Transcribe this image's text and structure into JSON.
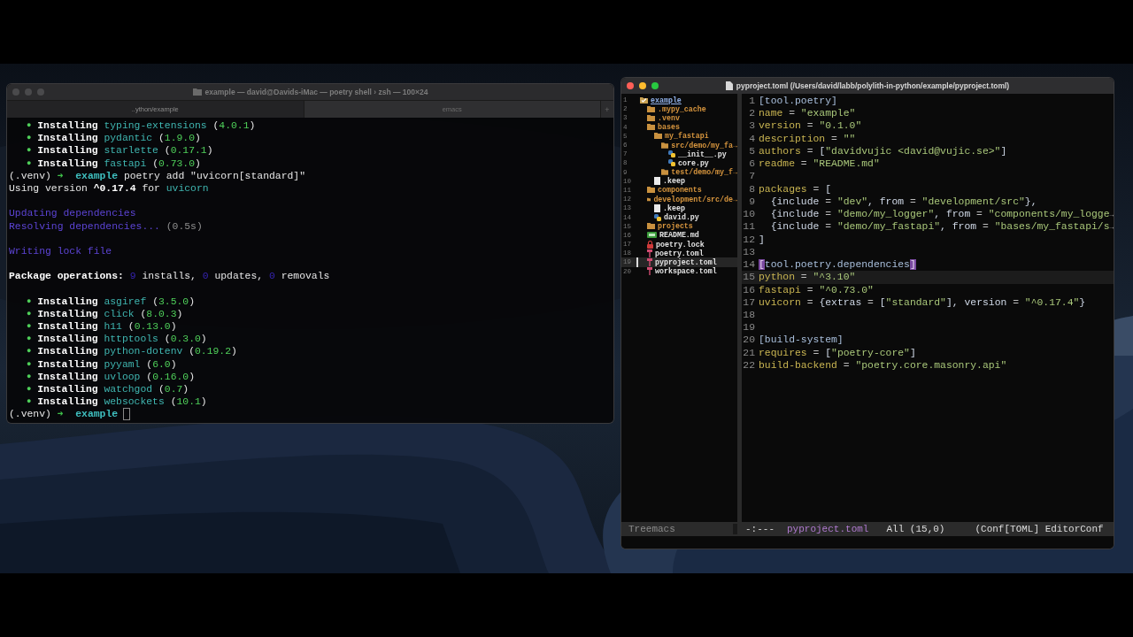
{
  "terminal": {
    "title": "example — david@Davids-iMac — poetry shell › zsh — 100×24",
    "tabs": [
      {
        "label": "..ython/example",
        "selected": true
      },
      {
        "label": "emacs",
        "selected": false
      }
    ],
    "new_tab": "+",
    "lines": [
      {
        "kind": "text",
        "segments": [
          {
            "text": "●",
            "kind": "bullet"
          },
          {
            "text": " Installing ",
            "kind": "bold"
          },
          {
            "text": "typing-extensions",
            "kind": "pkg"
          },
          {
            "text": " (",
            "kind": "plain"
          },
          {
            "text": "4.0.1",
            "kind": "ver"
          },
          {
            "text": ")",
            "kind": "plain"
          }
        ]
      },
      {
        "kind": "text",
        "segments": [
          {
            "text": "●",
            "kind": "bullet"
          },
          {
            "text": " Installing ",
            "kind": "bold"
          },
          {
            "text": "pydantic",
            "kind": "pkg"
          },
          {
            "text": " (",
            "kind": "plain"
          },
          {
            "text": "1.9.0",
            "kind": "ver"
          },
          {
            "text": ")",
            "kind": "plain"
          }
        ]
      },
      {
        "kind": "text",
        "segments": [
          {
            "text": "●",
            "kind": "bullet"
          },
          {
            "text": " Installing ",
            "kind": "bold"
          },
          {
            "text": "starlette",
            "kind": "pkg"
          },
          {
            "text": " (",
            "kind": "plain"
          },
          {
            "text": "0.17.1",
            "kind": "ver"
          },
          {
            "text": ")",
            "kind": "plain"
          }
        ]
      },
      {
        "kind": "text",
        "segments": [
          {
            "text": "●",
            "kind": "bullet"
          },
          {
            "text": " Installing ",
            "kind": "bold"
          },
          {
            "text": "fastapi",
            "kind": "pkg"
          },
          {
            "text": " (",
            "kind": "plain"
          },
          {
            "text": "0.73.0",
            "kind": "ver"
          },
          {
            "text": ")",
            "kind": "plain"
          }
        ]
      },
      {
        "kind": "text",
        "segments": [
          {
            "text": "(.venv) ",
            "kind": "plain"
          },
          {
            "text": "➜",
            "kind": "arrow"
          },
          {
            "text": "  example",
            "kind": "dir"
          },
          {
            "text": " poetry add \"uvicorn[standard]\"",
            "kind": "plain"
          }
        ]
      },
      {
        "kind": "text",
        "segments": [
          {
            "text": "Using version ",
            "kind": "plain"
          },
          {
            "text": "^0.17.4",
            "kind": "bold"
          },
          {
            "text": " for ",
            "kind": "plain"
          },
          {
            "text": "uvicorn",
            "kind": "pkg"
          }
        ]
      },
      {
        "kind": "blank"
      },
      {
        "kind": "text",
        "segments": [
          {
            "text": "Updating dependencies",
            "kind": "purple"
          }
        ]
      },
      {
        "kind": "text",
        "segments": [
          {
            "text": "Resolving dependencies...",
            "kind": "purple"
          },
          {
            "text": " (0.5s)",
            "kind": "grey"
          }
        ]
      },
      {
        "kind": "blank"
      },
      {
        "kind": "text",
        "segments": [
          {
            "text": "Writing lock file",
            "kind": "purple"
          }
        ]
      },
      {
        "kind": "blank"
      },
      {
        "kind": "text",
        "segments": [
          {
            "text": "Package operations: ",
            "kind": "bold"
          },
          {
            "text": "9",
            "kind": "num"
          },
          {
            "text": " installs, ",
            "kind": "plain"
          },
          {
            "text": "0",
            "kind": "num"
          },
          {
            "text": " updates, ",
            "kind": "plain"
          },
          {
            "text": "0",
            "kind": "num"
          },
          {
            "text": " removals",
            "kind": "plain"
          }
        ]
      },
      {
        "kind": "blank"
      },
      {
        "kind": "text",
        "segments": [
          {
            "text": "●",
            "kind": "bullet"
          },
          {
            "text": " Installing ",
            "kind": "bold"
          },
          {
            "text": "asgiref",
            "kind": "pkg"
          },
          {
            "text": " (",
            "kind": "plain"
          },
          {
            "text": "3.5.0",
            "kind": "ver"
          },
          {
            "text": ")",
            "kind": "plain"
          }
        ]
      },
      {
        "kind": "text",
        "segments": [
          {
            "text": "●",
            "kind": "bullet"
          },
          {
            "text": " Installing ",
            "kind": "bold"
          },
          {
            "text": "click",
            "kind": "pkg"
          },
          {
            "text": " (",
            "kind": "plain"
          },
          {
            "text": "8.0.3",
            "kind": "ver"
          },
          {
            "text": ")",
            "kind": "plain"
          }
        ]
      },
      {
        "kind": "text",
        "segments": [
          {
            "text": "●",
            "kind": "bullet"
          },
          {
            "text": " Installing ",
            "kind": "bold"
          },
          {
            "text": "h11",
            "kind": "pkg"
          },
          {
            "text": " (",
            "kind": "plain"
          },
          {
            "text": "0.13.0",
            "kind": "ver"
          },
          {
            "text": ")",
            "kind": "plain"
          }
        ]
      },
      {
        "kind": "text",
        "segments": [
          {
            "text": "●",
            "kind": "bullet"
          },
          {
            "text": " Installing ",
            "kind": "bold"
          },
          {
            "text": "httptools",
            "kind": "pkg"
          },
          {
            "text": " (",
            "kind": "plain"
          },
          {
            "text": "0.3.0",
            "kind": "ver"
          },
          {
            "text": ")",
            "kind": "plain"
          }
        ]
      },
      {
        "kind": "text",
        "segments": [
          {
            "text": "●",
            "kind": "bullet"
          },
          {
            "text": " Installing ",
            "kind": "bold"
          },
          {
            "text": "python-dotenv",
            "kind": "pkg"
          },
          {
            "text": " (",
            "kind": "plain"
          },
          {
            "text": "0.19.2",
            "kind": "ver"
          },
          {
            "text": ")",
            "kind": "plain"
          }
        ]
      },
      {
        "kind": "text",
        "segments": [
          {
            "text": "●",
            "kind": "bullet"
          },
          {
            "text": " Installing ",
            "kind": "bold"
          },
          {
            "text": "pyyaml",
            "kind": "pkg"
          },
          {
            "text": " (",
            "kind": "plain"
          },
          {
            "text": "6.0",
            "kind": "ver"
          },
          {
            "text": ")",
            "kind": "plain"
          }
        ]
      },
      {
        "kind": "text",
        "segments": [
          {
            "text": "●",
            "kind": "bullet"
          },
          {
            "text": " Installing ",
            "kind": "bold"
          },
          {
            "text": "uvloop",
            "kind": "pkg"
          },
          {
            "text": " (",
            "kind": "plain"
          },
          {
            "text": "0.16.0",
            "kind": "ver"
          },
          {
            "text": ")",
            "kind": "plain"
          }
        ]
      },
      {
        "kind": "text",
        "segments": [
          {
            "text": "●",
            "kind": "bullet"
          },
          {
            "text": " Installing ",
            "kind": "bold"
          },
          {
            "text": "watchgod",
            "kind": "pkg"
          },
          {
            "text": " (",
            "kind": "plain"
          },
          {
            "text": "0.7",
            "kind": "ver"
          },
          {
            "text": ")",
            "kind": "plain"
          }
        ]
      },
      {
        "kind": "text",
        "segments": [
          {
            "text": "●",
            "kind": "bullet"
          },
          {
            "text": " Installing ",
            "kind": "bold"
          },
          {
            "text": "websockets",
            "kind": "pkg"
          },
          {
            "text": " (",
            "kind": "plain"
          },
          {
            "text": "10.1",
            "kind": "ver"
          },
          {
            "text": ")",
            "kind": "plain"
          }
        ]
      },
      {
        "kind": "prompt",
        "segments": [
          {
            "text": "(.venv) ",
            "kind": "plain"
          },
          {
            "text": "➜",
            "kind": "arrow"
          },
          {
            "text": "  example",
            "kind": "dir"
          }
        ]
      }
    ]
  },
  "editor": {
    "title": "pyproject.toml (/Users/david/labb/polylith-in-python/example/pyproject.toml)",
    "tree": [
      {
        "line": "1",
        "label": "example",
        "kind": "root",
        "selected": false,
        "children": [
          {
            "line": "2",
            "label": ".mypy_cache",
            "kind": "folder",
            "selected": false
          },
          {
            "line": "3",
            "label": ".venv",
            "kind": "folder",
            "selected": false
          },
          {
            "line": "4",
            "label": "bases",
            "kind": "folder",
            "selected": false,
            "children": [
              {
                "line": "5",
                "label": "my_fastapi",
                "kind": "folder",
                "selected": false,
                "children": [
                  {
                    "line": "6",
                    "label": "src/demo/my_fa→",
                    "kind": "folder",
                    "selected": false,
                    "children": [
                      {
                        "line": "7",
                        "label": "__init__.py",
                        "kind": "python",
                        "selected": false
                      },
                      {
                        "line": "8",
                        "label": "core.py",
                        "kind": "python",
                        "selected": false
                      }
                    ]
                  },
                  {
                    "line": "9",
                    "label": "test/demo/my_f→",
                    "kind": "folder",
                    "selected": false
                  }
                ]
              },
              {
                "line": "10",
                "label": ".keep",
                "kind": "file",
                "selected": false
              }
            ]
          },
          {
            "line": "11",
            "label": "components",
            "kind": "folder",
            "selected": false
          },
          {
            "line": "12",
            "label": "development/src/de→",
            "kind": "folder",
            "selected": false,
            "children": [
              {
                "line": "13",
                "label": ".keep",
                "kind": "file",
                "selected": false
              },
              {
                "line": "14",
                "label": "david.py",
                "kind": "python",
                "selected": false
              }
            ]
          },
          {
            "line": "15",
            "label": "projects",
            "kind": "folder",
            "selected": false
          },
          {
            "line": "16",
            "label": "README.md",
            "kind": "markdown",
            "selected": false
          },
          {
            "line": "17",
            "label": "poetry.lock",
            "kind": "lock",
            "selected": false
          },
          {
            "line": "18",
            "label": "poetry.toml",
            "kind": "toml",
            "selected": false
          },
          {
            "line": "19",
            "label": "pyproject.toml",
            "kind": "toml",
            "selected": true
          },
          {
            "line": "20",
            "label": "workspace.toml",
            "kind": "toml",
            "selected": false
          }
        ]
      }
    ],
    "code": [
      {
        "number": "1",
        "selected": false,
        "segments": [
          {
            "text": "[tool.poetry]",
            "kind": "section"
          }
        ]
      },
      {
        "number": "2",
        "selected": false,
        "segments": [
          {
            "text": "name",
            "kind": "key"
          },
          {
            "text": " = ",
            "kind": "op"
          },
          {
            "text": "\"example\"",
            "kind": "str"
          }
        ]
      },
      {
        "number": "3",
        "selected": false,
        "segments": [
          {
            "text": "version",
            "kind": "key"
          },
          {
            "text": " = ",
            "kind": "op"
          },
          {
            "text": "\"0.1.0\"",
            "kind": "str"
          }
        ]
      },
      {
        "number": "4",
        "selected": false,
        "segments": [
          {
            "text": "description",
            "kind": "key"
          },
          {
            "text": " = ",
            "kind": "op"
          },
          {
            "text": "\"\"",
            "kind": "str"
          }
        ]
      },
      {
        "number": "5",
        "selected": false,
        "segments": [
          {
            "text": "authors",
            "kind": "key"
          },
          {
            "text": " = ",
            "kind": "op"
          },
          {
            "text": "[",
            "kind": "punct"
          },
          {
            "text": "\"davidvujic <david@vujic.se>\"",
            "kind": "str"
          },
          {
            "text": "]",
            "kind": "punct"
          }
        ]
      },
      {
        "number": "6",
        "selected": false,
        "segments": [
          {
            "text": "readme",
            "kind": "key"
          },
          {
            "text": " = ",
            "kind": "op"
          },
          {
            "text": "\"README.md\"",
            "kind": "str"
          }
        ]
      },
      {
        "number": "7",
        "selected": false
      },
      {
        "number": "8",
        "selected": false,
        "segments": [
          {
            "text": "packages",
            "kind": "key"
          },
          {
            "text": " = ",
            "kind": "op"
          },
          {
            "text": "[",
            "kind": "punct"
          }
        ]
      },
      {
        "number": "9",
        "selected": false,
        "segments": [
          {
            "text": "  {include",
            "kind": "punct"
          },
          {
            "text": " = ",
            "kind": "op"
          },
          {
            "text": "\"dev\"",
            "kind": "str"
          },
          {
            "text": ", from",
            "kind": "punct"
          },
          {
            "text": " = ",
            "kind": "op"
          },
          {
            "text": "\"development/src\"",
            "kind": "str"
          },
          {
            "text": "},",
            "kind": "punct"
          }
        ]
      },
      {
        "number": "10",
        "selected": false,
        "segments": [
          {
            "text": "  {include",
            "kind": "punct"
          },
          {
            "text": " = ",
            "kind": "op"
          },
          {
            "text": "\"demo/my_logger\"",
            "kind": "str"
          },
          {
            "text": ", from",
            "kind": "punct"
          },
          {
            "text": " = ",
            "kind": "op"
          },
          {
            "text": "\"components/my_logge",
            "kind": "str"
          },
          {
            "text": "→",
            "kind": "more"
          }
        ]
      },
      {
        "number": "11",
        "selected": false,
        "segments": [
          {
            "text": "  {include",
            "kind": "punct"
          },
          {
            "text": " = ",
            "kind": "op"
          },
          {
            "text": "\"demo/my_fastapi\"",
            "kind": "str"
          },
          {
            "text": ", from",
            "kind": "punct"
          },
          {
            "text": " = ",
            "kind": "op"
          },
          {
            "text": "\"bases/my_fastapi/s",
            "kind": "str"
          },
          {
            "text": "→",
            "kind": "more"
          }
        ]
      },
      {
        "number": "12",
        "selected": false,
        "segments": [
          {
            "text": "]",
            "kind": "punct"
          }
        ]
      },
      {
        "number": "13",
        "selected": false
      },
      {
        "number": "14",
        "selected": false,
        "segments": [
          {
            "text": "[",
            "kind": "paren"
          },
          {
            "text": "tool.poetry.dependencies",
            "kind": "section"
          },
          {
            "text": "]",
            "kind": "paren"
          }
        ]
      },
      {
        "number": "15",
        "selected": true,
        "segments": [
          {
            "text": "python",
            "kind": "key"
          },
          {
            "text": " = ",
            "kind": "op"
          },
          {
            "text": "\"^3.10\"",
            "kind": "str"
          }
        ]
      },
      {
        "number": "16",
        "selected": false,
        "segments": [
          {
            "text": "fastapi",
            "kind": "key"
          },
          {
            "text": " = ",
            "kind": "op"
          },
          {
            "text": "\"^0.73.0\"",
            "kind": "str"
          }
        ]
      },
      {
        "number": "17",
        "selected": false,
        "segments": [
          {
            "text": "uvicorn",
            "kind": "key"
          },
          {
            "text": " = ",
            "kind": "op"
          },
          {
            "text": "{extras",
            "kind": "punct"
          },
          {
            "text": " = ",
            "kind": "op"
          },
          {
            "text": "[",
            "kind": "punct"
          },
          {
            "text": "\"standard\"",
            "kind": "str"
          },
          {
            "text": "], version",
            "kind": "punct"
          },
          {
            "text": " = ",
            "kind": "op"
          },
          {
            "text": "\"^0.17.4\"",
            "kind": "str"
          },
          {
            "text": "}",
            "kind": "punct"
          }
        ]
      },
      {
        "number": "18",
        "selected": false
      },
      {
        "number": "19",
        "selected": false
      },
      {
        "number": "20",
        "selected": false,
        "segments": [
          {
            "text": "[build-system]",
            "kind": "section"
          }
        ]
      },
      {
        "number": "21",
        "selected": false,
        "segments": [
          {
            "text": "requires",
            "kind": "key"
          },
          {
            "text": " = ",
            "kind": "op"
          },
          {
            "text": "[",
            "kind": "punct"
          },
          {
            "text": "\"poetry-core\"",
            "kind": "str"
          },
          {
            "text": "]",
            "kind": "punct"
          }
        ]
      },
      {
        "number": "22",
        "selected": false,
        "segments": [
          {
            "text": "build-backend",
            "kind": "key"
          },
          {
            "text": " = ",
            "kind": "op"
          },
          {
            "text": "\"poetry.core.masonry.api\"",
            "kind": "str"
          }
        ]
      }
    ],
    "mode_line": {
      "tree_label": "Treemacs",
      "status": "-:---",
      "buffer": "pyproject.toml",
      "position": "All (15,0)",
      "modes": "(Conf[TOML] EditorConf"
    }
  }
}
